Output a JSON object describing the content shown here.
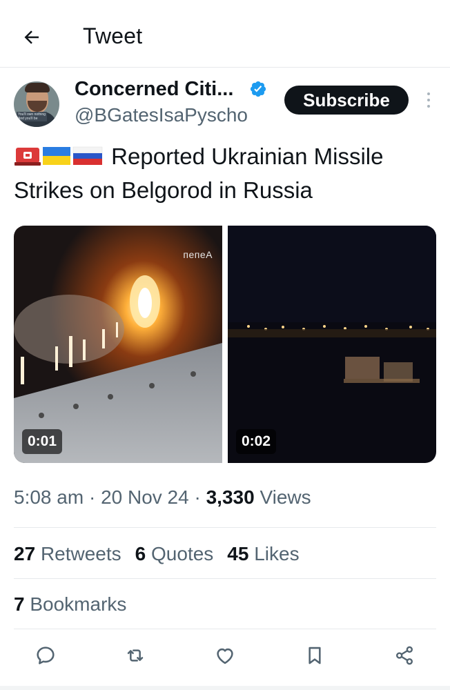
{
  "header": {
    "title": "Tweet",
    "back_icon": "arrow-left-icon"
  },
  "author": {
    "display_name": "Concerned Citi...",
    "handle": "@BGatesIsaPyscho",
    "verified": true,
    "avatar_caption": "You'll own nothing And you'll be happy"
  },
  "subscribe_label": "Subscribe",
  "tweet": {
    "emojis": [
      "rotating-light-emoji",
      "ukraine-flag-emoji",
      "russia-flag-emoji"
    ],
    "text": "Reported Ukrainian Missile Strikes on Belgorod in Russia"
  },
  "media": {
    "videos": [
      {
        "duration": "0:01",
        "watermark": "пепеА"
      },
      {
        "duration": "0:02"
      }
    ]
  },
  "meta": {
    "time": "5:08 am",
    "date": "20 Nov 24",
    "views_count": "3,330",
    "views_label": "Views",
    "separator": "·"
  },
  "stats": {
    "retweets_count": "27",
    "retweets_label": "Retweets",
    "quotes_count": "6",
    "quotes_label": "Quotes",
    "likes_count": "45",
    "likes_label": "Likes",
    "bookmarks_count": "7",
    "bookmarks_label": "Bookmarks"
  },
  "actions": [
    "reply-icon",
    "retweet-icon",
    "like-icon",
    "bookmark-icon",
    "share-icon"
  ],
  "colors": {
    "text_primary": "#0f1419",
    "text_secondary": "#536471",
    "verified_blue": "#1d9bf0",
    "divider": "#e6e9ec"
  }
}
